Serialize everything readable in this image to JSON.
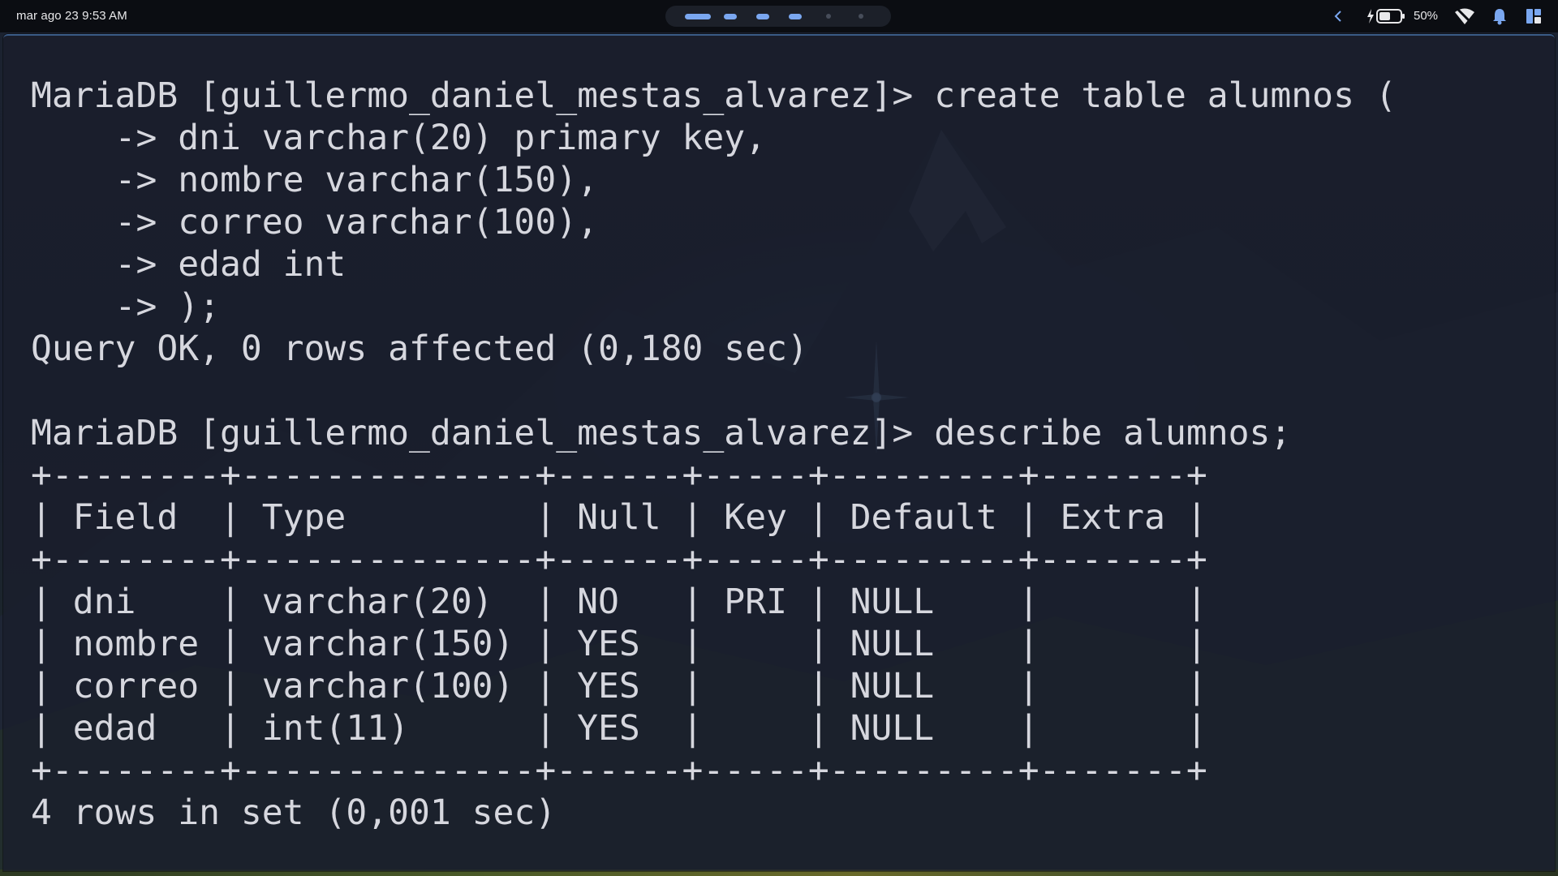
{
  "status_bar": {
    "datetime": "mar ago 23  9:53 AM",
    "battery_percent": "50%",
    "workspace_count": 6,
    "active_workspaces": 4,
    "icons": [
      "chevron-left-icon",
      "battery-charging-icon",
      "wifi-icon",
      "bell-icon",
      "panel-icon"
    ]
  },
  "terminal": {
    "lines": [
      "MariaDB [guillermo_daniel_mestas_alvarez]> create table alumnos (",
      "    -> dni varchar(20) primary key,",
      "    -> nombre varchar(150),",
      "    -> correo varchar(100),",
      "    -> edad int",
      "    -> );",
      "Query OK, 0 rows affected (0,180 sec)",
      "",
      "MariaDB [guillermo_daniel_mestas_alvarez]> describe alumnos;",
      "+--------+--------------+------+-----+---------+-------+",
      "| Field  | Type         | Null | Key | Default | Extra |",
      "+--------+--------------+------+-----+---------+-------+",
      "| dni    | varchar(20)  | NO   | PRI | NULL    |       |",
      "| nombre | varchar(150) | YES  |     | NULL    |       |",
      "| correo | varchar(100) | YES  |     | NULL    |       |",
      "| edad   | int(11)      | YES  |     | NULL    |       |",
      "+--------+--------------+------+-----+---------+-------+",
      "4 rows in set (0,001 sec)"
    ]
  },
  "colors": {
    "accent": "#7aa7f0",
    "terminal_text": "#d6d7de",
    "topbar_bg": "#0b0d12"
  }
}
